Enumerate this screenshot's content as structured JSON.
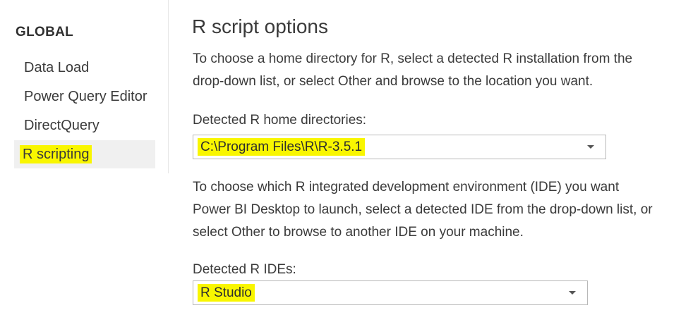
{
  "sidebar": {
    "heading": "GLOBAL",
    "items": [
      {
        "label": "Data Load"
      },
      {
        "label": "Power Query Editor"
      },
      {
        "label": "DirectQuery"
      },
      {
        "label": "R scripting",
        "selected": true
      }
    ]
  },
  "main": {
    "title": "R script options",
    "home_desc_line1": "To choose a home directory for R, select a detected R installation from the",
    "home_desc_line2": "drop-down list, or select Other and browse to the location you want.",
    "home_label": "Detected R home directories:",
    "home_value": "C:\\Program Files\\R\\R-3.5.1",
    "ide_desc_line1": "To choose which R integrated development environment (IDE) you want",
    "ide_desc_line2": "Power BI Desktop to launch, select a detected IDE from the drop-down list, or",
    "ide_desc_line3": "select Other to browse to another IDE on your machine.",
    "ide_label": "Detected R IDEs:",
    "ide_value": "R Studio"
  },
  "colors": {
    "highlight": "#f9f600",
    "selected_bg": "#f0f0f0",
    "text": "#3b3b3b"
  }
}
